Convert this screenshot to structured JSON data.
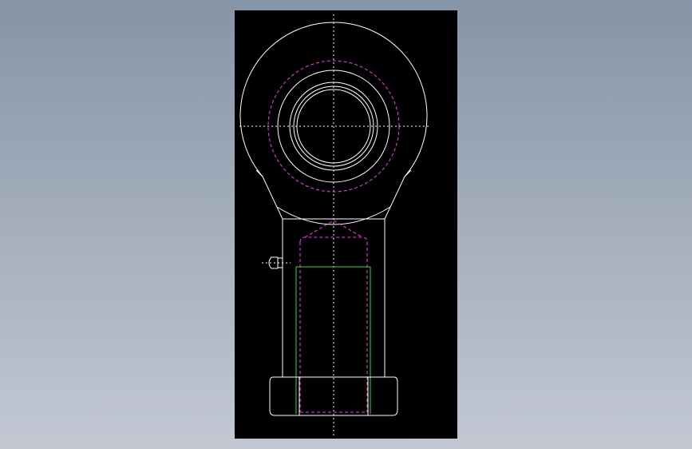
{
  "canvas": {
    "background": "#000000",
    "app_background_top": "#8594a6",
    "app_background_bottom": "#c3c8d3"
  },
  "colors": {
    "outline": "#ffffff",
    "hidden_line": "#ff33ff",
    "thread": "#33dd33",
    "centerline": "#ffffff"
  },
  "drawing": {
    "subject": "rod-end-bearing-front-view",
    "views": [
      "head-eye",
      "shank",
      "threaded-bore",
      "grease-nipple",
      "hex-nut"
    ]
  }
}
